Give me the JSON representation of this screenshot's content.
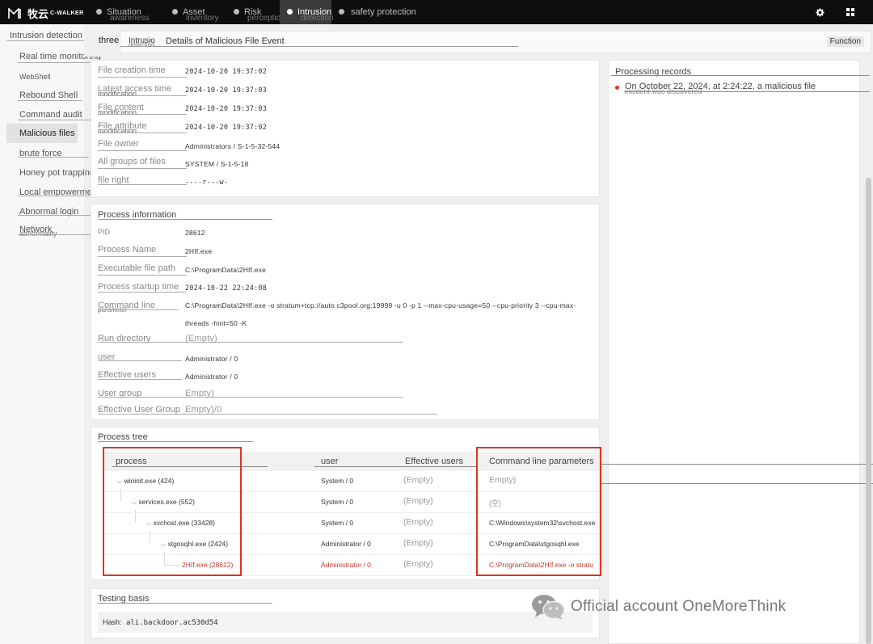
{
  "brand": {
    "cn": "牧云",
    "en": "C-WALKER"
  },
  "nav": [
    {
      "label": "Situation",
      "sub": "awareness"
    },
    {
      "label": "Asset",
      "sub": "inventory"
    },
    {
      "label": "Risk",
      "sub": "perception"
    },
    {
      "label": "Intrusion",
      "sub": "detection"
    },
    {
      "label": "safety protection",
      "sub": ""
    }
  ],
  "top_icons": [
    "settings-icon",
    "apps-grid-icon"
  ],
  "sidebar": {
    "header": "Intrusion detection",
    "items": [
      "Real time monitoring",
      "WebShell",
      "Rebound Shell",
      "Command audit",
      "Malicious files",
      "brute force",
      "Honey pot trapping",
      "Local empowerment",
      "Abnormal login",
      "Network",
      "abnormality"
    ]
  },
  "breadcrumb": {
    "prefix": "three",
    "tab": "Intrusio",
    "tab_sub": "detection",
    "title": "Details of Malicious File Event",
    "function_label": "Function"
  },
  "file_props": [
    {
      "label": "File creation time",
      "sub": "",
      "value": "2024-10-20 19:37:02"
    },
    {
      "label": "Latest access time",
      "sub": "modification",
      "value": "2024-10-20 19:37:03"
    },
    {
      "label": "File content",
      "sub": "modification",
      "value": "2024-10-20 19:37:03"
    },
    {
      "label": "File attribute",
      "sub": "modification",
      "value": "2024-10-20 19:37:02"
    },
    {
      "label": "File owner",
      "sub": "",
      "value": "Administrators / S-1-5-32-544"
    },
    {
      "label": "All groups of files",
      "sub": "",
      "value": "SYSTEM / S-1-5-18"
    },
    {
      "label": "file right",
      "sub": "",
      "value": "----r---w-"
    }
  ],
  "process_info": {
    "title": "Process information",
    "rows": [
      {
        "label": "PID",
        "value": "28612"
      },
      {
        "label": "Process Name",
        "value": "2HIf.exe"
      },
      {
        "label": "Executable file path",
        "value": "C:\\ProgramData\\2HIf.exe"
      },
      {
        "label": "Process startup time",
        "value": "2024-10-22 22:24:08"
      },
      {
        "label": "Command line",
        "sub": "parameter",
        "value": "C:\\ProgramData\\2HIf.exe -o stratum+tcp://auto.c3pool.org:19999 -u 0 -p 1 --max-cpu-usage=50 --cpu-priority 3 --cpu-max-threads -hint=50 -K"
      },
      {
        "label": "Run directory",
        "value": "(Empty)"
      },
      {
        "label": "user",
        "value": "Administrator / 0"
      },
      {
        "label": "Effective users",
        "value": "Administrator / 0"
      },
      {
        "label": "User group",
        "value": "Empty)"
      },
      {
        "label": "Effective User Group",
        "value": "Empty)/0"
      }
    ]
  },
  "process_tree": {
    "title": "Process tree",
    "columns": [
      "process",
      "user",
      "Effective users",
      "Command line parameters"
    ],
    "rows": [
      {
        "process": "wininit.exe (424)",
        "user": "System / 0",
        "effective": "(Empty)",
        "cmd": "Empty)"
      },
      {
        "process": "services.exe (552)",
        "user": "System / 0",
        "effective": "(Empty)",
        "cmd": "(空)"
      },
      {
        "process": "svchost.exe (33428)",
        "user": "System / 0",
        "effective": "(Empty)",
        "cmd": "C:\\Windows\\system32\\svchost.exe"
      },
      {
        "process": "xtgosqhl.exe (2424)",
        "user": "Administrator / 0",
        "effective": "(Empty)",
        "cmd": "C:\\ProgramData\\xtgosqhl.exe"
      },
      {
        "process": "2HIf.exe (28612)",
        "user": "Administrator / 0",
        "effective": "(Empty)",
        "cmd": "C:\\ProgramData\\2HIf.exe -o stratu"
      }
    ]
  },
  "testing_basis": {
    "title": "Testing basis",
    "hash_label": "Hash:",
    "hash_value": "ali.backdoor.ac530d54"
  },
  "processing_records": {
    "title": "Processing records",
    "entry": "On October 22, 2024, at 2:24:22, a malicious file",
    "entry_sub": "incident was discovered"
  },
  "watermark": "Official account OneMoreThink",
  "colors": {
    "topbar": "#0e0e0e",
    "highlight_box": "#e0331f",
    "malicious_row": "#c0392b"
  }
}
